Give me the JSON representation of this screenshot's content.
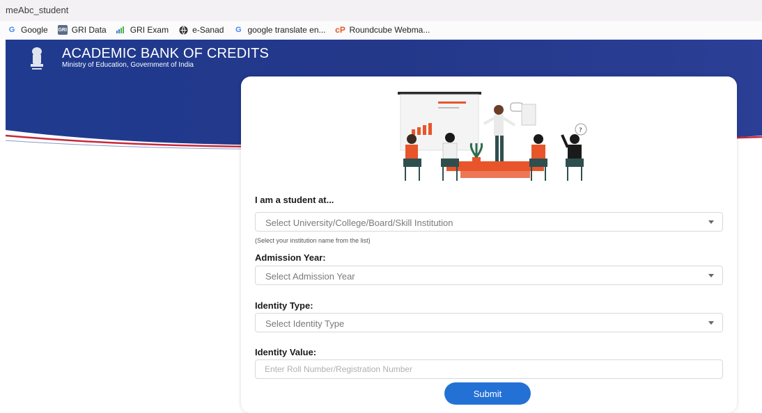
{
  "browser": {
    "tab_title": "meAbc_student",
    "bookmarks": [
      {
        "label": "Google",
        "icon": "google-icon"
      },
      {
        "label": "GRI Data",
        "icon": "gri-data-icon"
      },
      {
        "label": "GRI Exam",
        "icon": "gri-exam-icon"
      },
      {
        "label": "e-Sanad",
        "icon": "globe-icon"
      },
      {
        "label": "google translate en...",
        "icon": "google-icon"
      },
      {
        "label": "Roundcube Webma...",
        "icon": "roundcube-icon"
      }
    ]
  },
  "header": {
    "title": "ACADEMIC BANK OF CREDITS",
    "subtitle": "Ministry of Education, Government of India"
  },
  "form": {
    "institution": {
      "label": "I am a student at...",
      "placeholder": "Select University/College/Board/Skill Institution",
      "hint": "(Select your institution name from the list)"
    },
    "admission_year": {
      "label": "Admission Year:",
      "placeholder": "Select Admission Year"
    },
    "identity_type": {
      "label": "Identity Type:",
      "placeholder": "Select Identity Type"
    },
    "identity_value": {
      "label": "Identity Value:",
      "placeholder": "Enter Roll Number/Registration Number"
    },
    "submit_label": "Submit"
  },
  "colors": {
    "banner_blue": "#233a8c",
    "accent_red": "#c8283a",
    "button_blue": "#2471d6",
    "illustration_orange": "#e8552a"
  }
}
